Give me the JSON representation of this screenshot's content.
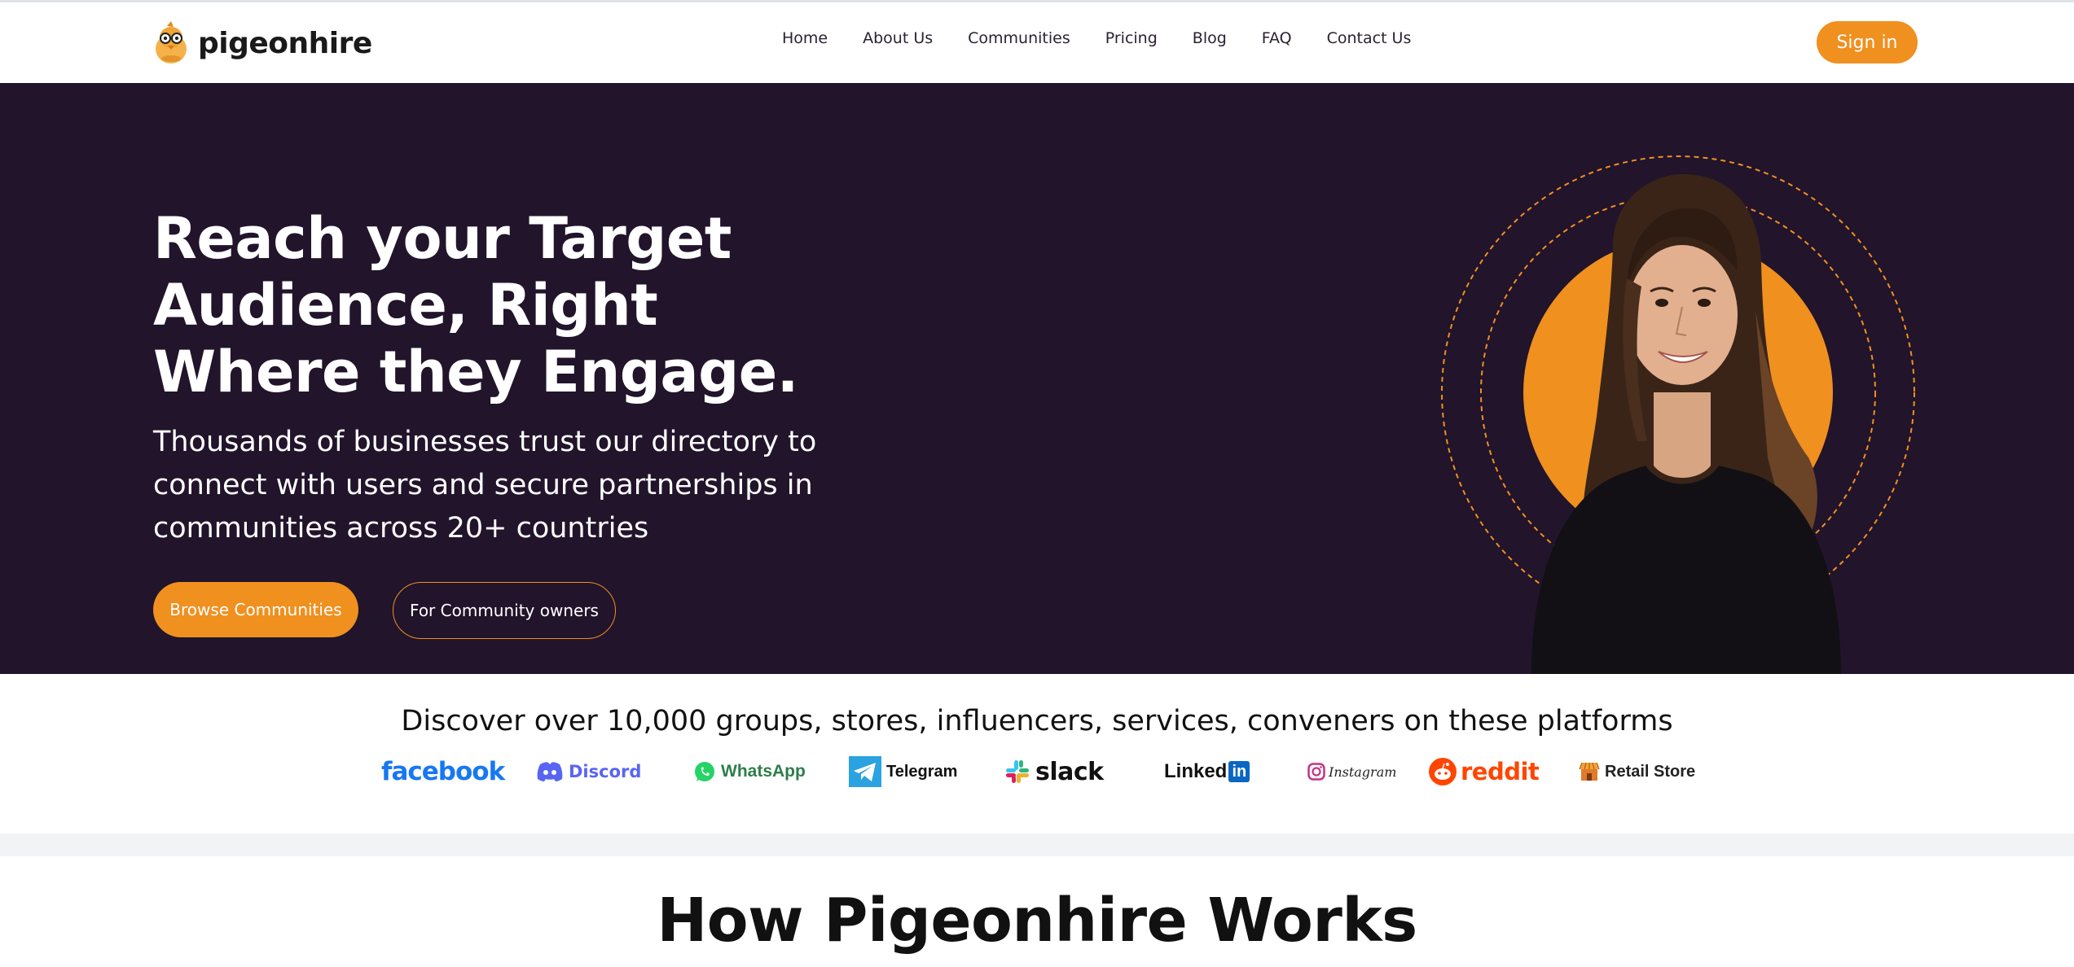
{
  "brand": {
    "name": "pigeonhire",
    "accent": "#f0901f",
    "hero_bg": "#21142b"
  },
  "nav": {
    "items": [
      {
        "label": "Home"
      },
      {
        "label": "About Us"
      },
      {
        "label": "Communities"
      },
      {
        "label": "Pricing"
      },
      {
        "label": "Blog"
      },
      {
        "label": "FAQ"
      },
      {
        "label": "Contact Us"
      }
    ],
    "sign_in": "Sign in"
  },
  "hero": {
    "title": "Reach your Target Audience, Right Where they Engage.",
    "subtitle": "Thousands of businesses trust our directory to connect with users and secure partnerships in communities across 20+ countries",
    "primary_button": "Browse Communities",
    "secondary_button": "For Community owners"
  },
  "platforms": {
    "heading": "Discover over 10,000 groups, stores, influencers, services, conveners on these platforms",
    "items": [
      {
        "label": "facebook",
        "icon": "facebook-logo",
        "color": "#1877f2"
      },
      {
        "label": "Discord",
        "icon": "discord-logo",
        "color": "#5865f2"
      },
      {
        "label": "WhatsApp",
        "icon": "whatsapp-logo",
        "color": "#25d366"
      },
      {
        "label": "Telegram",
        "icon": "telegram-logo",
        "color": "#2aa3e0"
      },
      {
        "label": "slack",
        "icon": "slack-logo",
        "color": "#111111"
      },
      {
        "label": "Linked",
        "label_badge": "in",
        "icon": "linkedin-logo",
        "color": "#0a66c2"
      },
      {
        "label": "Instagram",
        "icon": "instagram-logo",
        "color": "#c13584"
      },
      {
        "label": "reddit",
        "icon": "reddit-logo",
        "color": "#ff4500"
      },
      {
        "label": "Retail Store",
        "icon": "store-icon",
        "color": "#e07b2a"
      }
    ]
  },
  "how": {
    "title": "How Pigeonhire Works"
  }
}
